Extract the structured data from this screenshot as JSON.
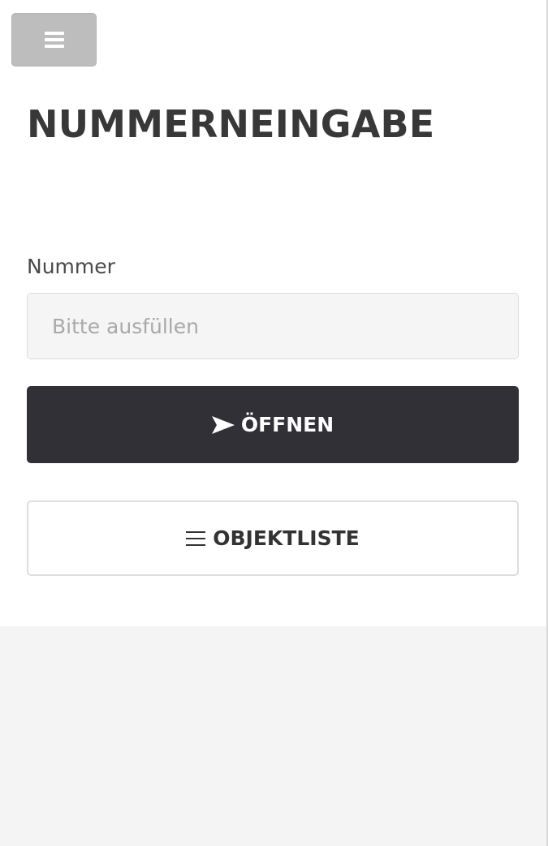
{
  "header": {
    "menu_icon": "hamburger-menu-icon"
  },
  "page": {
    "title": "NUMMERNEINGABE"
  },
  "form": {
    "number_label": "Nummer",
    "number_value": "",
    "number_placeholder": "Bitte ausfüllen"
  },
  "actions": {
    "open_label": "ÖFFNEN",
    "open_icon": "send-arrow-icon",
    "list_label": "OBJEKTLISTE",
    "list_icon": "list-icon"
  },
  "colors": {
    "primary_button": "#313036",
    "menu_button": "#bdbdbd",
    "page_background": "#f4f4f4",
    "panel_background": "#ffffff"
  }
}
